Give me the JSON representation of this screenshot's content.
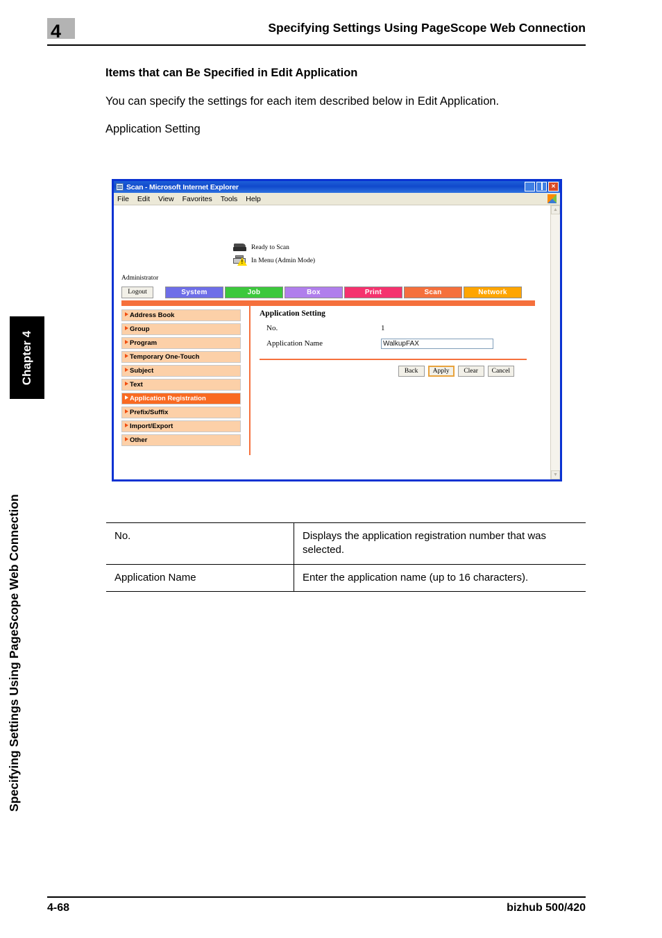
{
  "page": {
    "header_chapter_number": "4",
    "header_title": "Specifying Settings Using PageScope Web Connection",
    "side_chapter_tab": "Chapter 4",
    "side_running_title": "Specifying Settings Using PageScope Web Connection",
    "footer_page_number": "4-68",
    "footer_product": "bizhub 500/420"
  },
  "body": {
    "heading": "Items that can Be Specified in Edit Application",
    "paragraph": "You can specify the settings for each item described below in Edit Application.",
    "caption": "Application Setting"
  },
  "browser": {
    "title": "Scan - Microsoft Internet Explorer",
    "title_icon": "ie-page-icon",
    "menu": [
      "File",
      "Edit",
      "View",
      "Favorites",
      "Tools",
      "Help"
    ],
    "window_buttons": [
      "minimize",
      "maximize",
      "close"
    ],
    "scrollbar": {
      "up_arrow": "▲",
      "down_arrow": "▼"
    }
  },
  "webpage": {
    "status": [
      {
        "icon": "scanner-icon",
        "text": "Ready to Scan"
      },
      {
        "icon": "printer-warning-icon",
        "text": "In Menu (Admin Mode)"
      }
    ],
    "user_label": "Administrator",
    "logout_label": "Logout",
    "tabs": [
      {
        "label": "System",
        "color": "#6e6ee8"
      },
      {
        "label": "Job",
        "color": "#3cc83c"
      },
      {
        "label": "Box",
        "color": "#b07eec"
      },
      {
        "label": "Print",
        "color": "#f5326e"
      },
      {
        "label": "Scan",
        "color": "#f5703c",
        "active": true
      },
      {
        "label": "Network",
        "color": "#ffa500"
      }
    ],
    "accent_color": "#f5703c",
    "sidebar": [
      {
        "label": "Address Book"
      },
      {
        "label": "Group"
      },
      {
        "label": "Program"
      },
      {
        "label": "Temporary One-Touch"
      },
      {
        "label": "Subject"
      },
      {
        "label": "Text"
      },
      {
        "label": "Application Registration",
        "active": true
      },
      {
        "label": "Prefix/Suffix"
      },
      {
        "label": "Import/Export"
      },
      {
        "label": "Other"
      }
    ],
    "panel": {
      "title": "Application Setting",
      "fields": [
        {
          "label": "No.",
          "value": "1",
          "type": "static"
        },
        {
          "label": "Application Name",
          "value": "WalkupFAX",
          "type": "input"
        }
      ],
      "buttons": [
        {
          "label": "Back"
        },
        {
          "label": "Apply",
          "primary": true
        },
        {
          "label": "Clear"
        },
        {
          "label": "Cancel"
        }
      ]
    }
  },
  "description_table": {
    "rows": [
      {
        "item": "No.",
        "description": "Displays the application registration number that was selected."
      },
      {
        "item": "Application Name",
        "description": "Enter the application name (up to 16 characters)."
      }
    ]
  }
}
